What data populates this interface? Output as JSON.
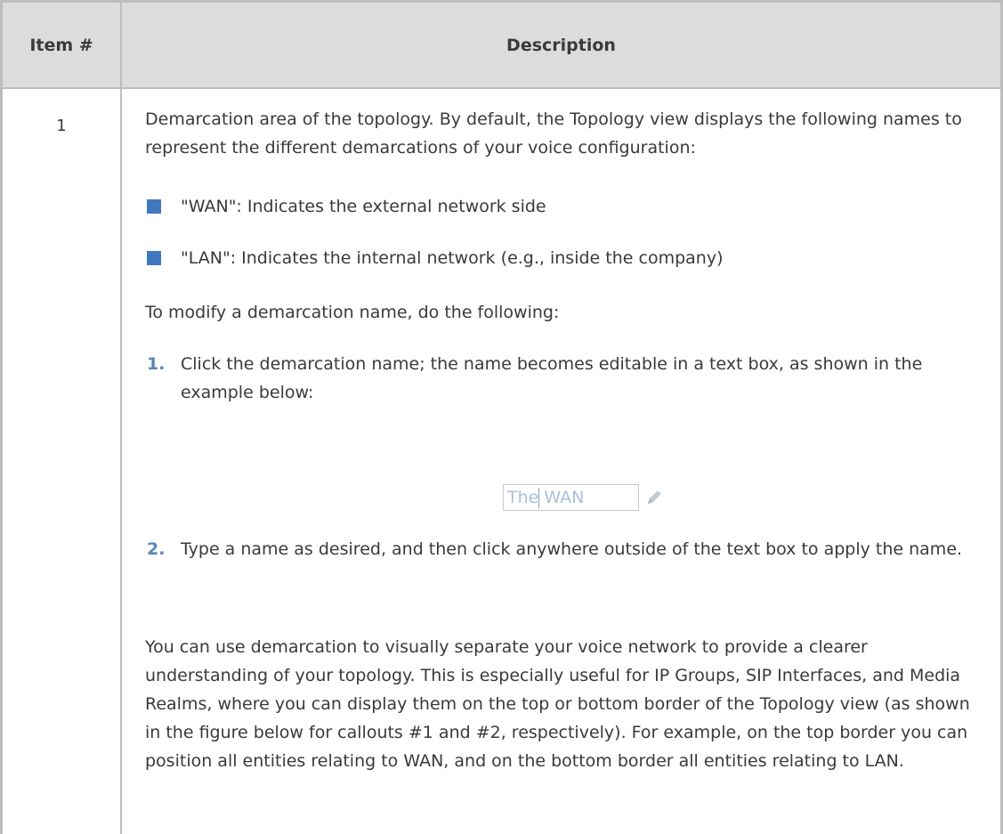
{
  "table": {
    "headers": [
      "Item #",
      "Description"
    ],
    "row": {
      "item_number": "1",
      "intro": "Demarcation area of the topology. By default, the Topology view displays the following names to represent the different demarcations of your voice configuration:",
      "bullets": [
        "\"WAN\": Indicates the external network side",
        "\"LAN\": Indicates the internal network (e.g., inside the company)"
      ],
      "steps_intro": "To modify a demarcation name, do the following:",
      "steps": [
        {
          "number": "1.",
          "text": "Click the demarcation name; the name becomes editable in a text box, as shown in the example below:"
        },
        {
          "number": "2.",
          "text": "Type a name as desired, and then click anywhere outside of the text box to apply the name."
        }
      ],
      "example_textbox": {
        "value": "The WAN"
      },
      "closing": "You can use demarcation to visually separate your voice network to provide a clearer understanding of your topology. This is especially useful for IP Groups, SIP Interfaces, and Media Realms, where you can display them on the top or bottom border of the Topology view (as shown in the figure below for callouts #1 and #2, respectively). For example, on the top border you can position all entities relating to WAN, and on the bottom border all entities relating to LAN."
    }
  },
  "colors": {
    "header_bg": "#dcdcdc",
    "border": "#bdbdbd",
    "bullet": "#3f78bf",
    "step_number": "#5b85b8",
    "textbox_text": "#a9bfdc"
  },
  "icons": {
    "edit": "pencil-icon"
  }
}
